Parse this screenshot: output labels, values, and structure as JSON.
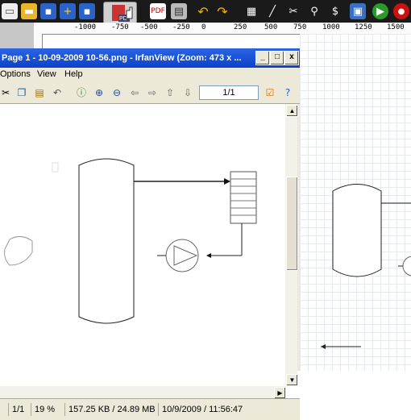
{
  "window": {
    "title": "Page 1 - 10-09-2009 10-56.png - IrfanView (Zoom: 473 x ...",
    "minimize_label": "_",
    "maximize_label": "□",
    "close_label": "x"
  },
  "menu": {
    "items": [
      {
        "label": "Options"
      },
      {
        "label": "View"
      },
      {
        "label": "Help"
      }
    ]
  },
  "toolbar": {
    "page_indicator": "1/1"
  },
  "ruler": {
    "ticks": [
      "-1000",
      "-750",
      "-500",
      "-250",
      "0",
      "250",
      "500",
      "750",
      "1000",
      "1250",
      "1500"
    ]
  },
  "status": {
    "page": "1/1",
    "zoom": "19 %",
    "size": "157.25 KB / 24.89 MB",
    "datetime": "10/9/2009 / 11:56:47"
  },
  "icons": {
    "top_toolbar": [
      "new-document-icon",
      "open-folder-icon",
      "save-icon",
      "add-icon",
      "save-as-icon",
      "export-pdf-icon",
      "pdf-icon",
      "print-icon",
      "undo-icon",
      "redo-icon",
      "grid-icon",
      "ruler-icon",
      "scissors-icon",
      "zoom-icon",
      "dollar-icon",
      "network-icon",
      "play-icon",
      "record-icon"
    ]
  },
  "colors": {
    "titlebar": "#0b42c9",
    "toolbar_bg": "#1a1a1a",
    "window_bg": "#ece9d8"
  }
}
